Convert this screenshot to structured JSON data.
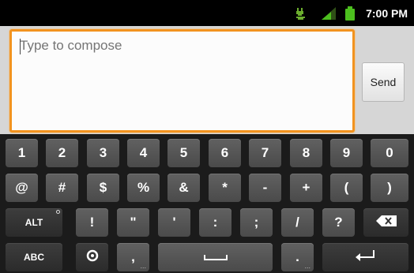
{
  "status_bar": {
    "time": "7:00 PM",
    "icons": [
      "usb-debug-icon",
      "signal-icon",
      "battery-icon"
    ],
    "battery_color": "#4cbf1e"
  },
  "compose": {
    "placeholder": "Type to compose",
    "value": "",
    "send_label": "Send",
    "focus_color": "#f2931f"
  },
  "keyboard": {
    "row1": [
      "1",
      "2",
      "3",
      "4",
      "5",
      "6",
      "7",
      "8",
      "9",
      "0"
    ],
    "row2": [
      "@",
      "#",
      "$",
      "%",
      "&",
      "*",
      "-",
      "+",
      "(",
      ")"
    ],
    "row3": {
      "alt": "ALT",
      "keys": [
        "!",
        "\"",
        "'",
        ":",
        ";",
        "/",
        "?"
      ],
      "backspace_icon": "backspace-icon"
    },
    "row4": {
      "abc": "ABC",
      "settings_icon": "settings-icon",
      "comma": ",",
      "comma_sub": "...",
      "space_icon": "space-icon",
      "period": ".",
      "period_sub": "...",
      "enter_icon": "enter-icon"
    }
  }
}
